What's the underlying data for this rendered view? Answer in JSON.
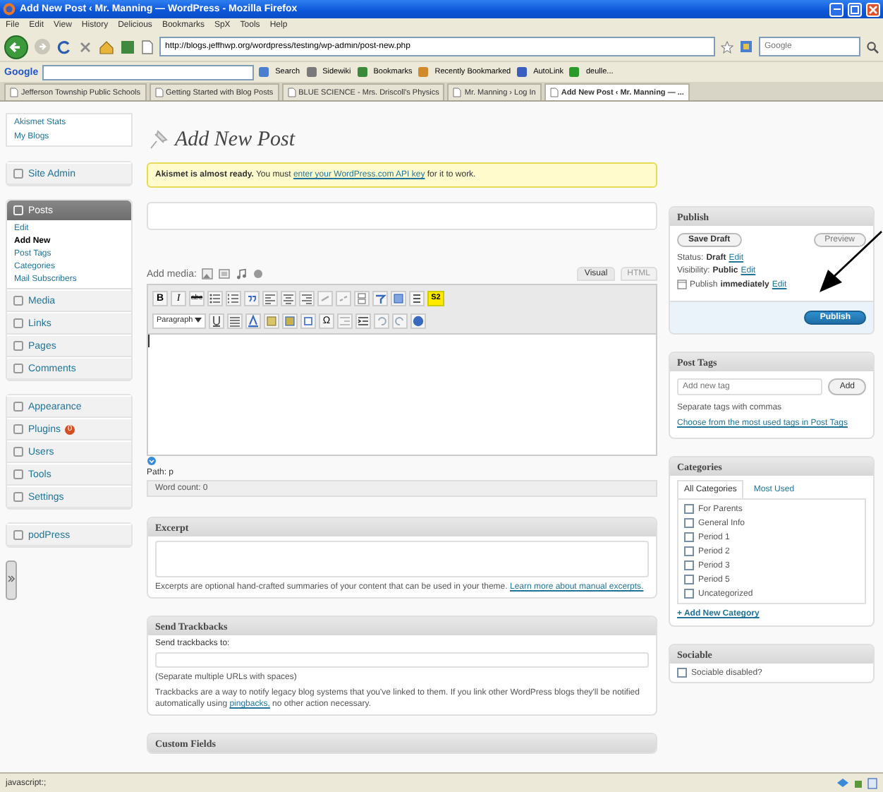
{
  "window": {
    "title": "Add New Post ‹ Mr. Manning — WordPress - Mozilla Firefox"
  },
  "menu": [
    "File",
    "Edit",
    "View",
    "History",
    "Delicious",
    "Bookmarks",
    "SpX",
    "Tools",
    "Help"
  ],
  "address": {
    "value": "http://blogs.jeffhwp.org/wordpress/testing/wp-admin/post-new.php"
  },
  "search": {
    "placeholder": "Google"
  },
  "google_toolbar": {
    "logo": "Google",
    "items": [
      "Search",
      "Sidewiki",
      "Bookmarks",
      "Recently Bookmarked",
      "AutoLink",
      "deulle..."
    ]
  },
  "tabs": [
    {
      "label": "Jefferson Township Public Schools",
      "selected": false
    },
    {
      "label": "Getting Started with Blog Posts",
      "selected": false
    },
    {
      "label": "BLUE SCIENCE - Mrs. Driscoll's Physics",
      "selected": false
    },
    {
      "label": "Mr. Manning › Log In",
      "selected": false
    },
    {
      "label": "Add New Post ‹ Mr. Manning — ...",
      "selected": true
    }
  ],
  "sidebar": {
    "links": [
      "Akismet Stats",
      "My Blogs"
    ],
    "menus": [
      [
        {
          "label": "Site Admin",
          "expanded": false
        }
      ],
      [
        {
          "label": "Posts",
          "expanded": true,
          "children": [
            {
              "label": "Edit",
              "selected": false
            },
            {
              "label": "Add New",
              "selected": true
            },
            {
              "label": "Post Tags",
              "selected": false
            },
            {
              "label": "Categories",
              "selected": false
            },
            {
              "label": "Mail Subscribers",
              "selected": false
            }
          ]
        },
        {
          "label": "Media",
          "expanded": false
        },
        {
          "label": "Links",
          "expanded": false
        },
        {
          "label": "Pages",
          "expanded": false
        },
        {
          "label": "Comments",
          "expanded": false
        }
      ],
      [
        {
          "label": "Appearance",
          "expanded": false
        },
        {
          "label": "Plugins",
          "expanded": false,
          "badge": "0"
        },
        {
          "label": "Users",
          "expanded": false
        },
        {
          "label": "Tools",
          "expanded": false
        },
        {
          "label": "Settings",
          "expanded": false
        }
      ],
      [
        {
          "label": "podPress",
          "expanded": false
        }
      ]
    ]
  },
  "page": {
    "heading": "Add New Post",
    "notice": {
      "before": "**Akismet is almost ready.** You must",
      "link": "enter your WordPress.com API key",
      "after": "for it to work."
    }
  },
  "editor": {
    "media_label": "Add media:",
    "modes": [
      {
        "label": "Visual",
        "selected": true
      },
      {
        "label": "HTML",
        "selected": false
      }
    ],
    "format_buttons": [
      "B",
      "I",
      "abc"
    ],
    "plugin_button": "S2",
    "format_select": "Paragraph",
    "symbol_button": "Ω",
    "path": "Path: p",
    "word_count": "Word count: 0"
  },
  "excerpt": {
    "title": "Excerpt",
    "help": "Excerpts are optional hand-crafted summaries of your content that can be used in your theme.",
    "link": "Learn more about manual excerpts."
  },
  "trackbacks": {
    "title": "Send Trackbacks",
    "label": "Send trackbacks to:",
    "hint": "(Separate multiple URLs with spaces)",
    "help": "Trackbacks are a way to notify legacy blog systems that you've linked to them. If you link other WordPress blogs they'll be notified automatically using",
    "link": "pingbacks,",
    "after": "no other action necessary."
  },
  "custom_fields": {
    "title": "Custom Fields"
  },
  "publish": {
    "title": "Publish",
    "save": "Save Draft",
    "preview": "Preview",
    "rows": [
      {
        "kind": "plain",
        "label": "Status:",
        "value": "Draft",
        "link": "Edit"
      },
      {
        "kind": "plain",
        "label": "Visibility:",
        "value": "Public",
        "link": "Edit"
      },
      {
        "kind": "date",
        "label": "Publish",
        "value": "immediately",
        "link": "Edit"
      }
    ],
    "button": "Publish"
  },
  "post_tags": {
    "title": "Post Tags",
    "placeholder": "Add new tag",
    "button": "Add",
    "hint": "Separate tags with commas",
    "link": "Choose from the most used tags in Post Tags"
  },
  "categories": {
    "title": "Categories",
    "tabs": [
      {
        "label": "All Categories",
        "selected": true
      },
      {
        "label": "Most Used",
        "selected": false
      }
    ],
    "items": [
      {
        "label": "For Parents",
        "checked": false
      },
      {
        "label": "General Info",
        "checked": false
      },
      {
        "label": "Period 1",
        "checked": false
      },
      {
        "label": "Period 2",
        "checked": false
      },
      {
        "label": "Period 3",
        "checked": false
      },
      {
        "label": "Period 5",
        "checked": false
      },
      {
        "label": "Uncategorized",
        "checked": false
      }
    ],
    "link": "+ Add New Category"
  },
  "sociable": {
    "title": "Sociable",
    "label": "Sociable disabled?",
    "checked": false
  },
  "status_bar": {
    "text": "javascript:;"
  }
}
